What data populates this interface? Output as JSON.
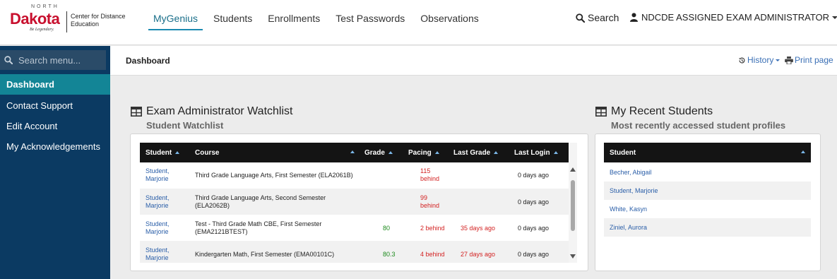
{
  "logo": {
    "north": "NORTH",
    "dakota": "Dakota",
    "tagline": "Be Legendary.",
    "org": "Center for Distance Education"
  },
  "nav": {
    "items": [
      {
        "label": "MyGenius",
        "active": true
      },
      {
        "label": "Students"
      },
      {
        "label": "Enrollments"
      },
      {
        "label": "Test Passwords"
      },
      {
        "label": "Observations"
      }
    ],
    "search_label": "Search",
    "user_label": "NDCDE ASSIGNED EXAM ADMINISTRATOR"
  },
  "sidebar": {
    "search_placeholder": "Search menu...",
    "items": [
      {
        "label": "Dashboard",
        "active": true
      },
      {
        "label": "Contact Support"
      },
      {
        "label": "Edit Account"
      },
      {
        "label": "My Acknowledgements"
      }
    ]
  },
  "breadcrumb": {
    "title": "Dashboard",
    "history_label": "History",
    "print_label": "Print page"
  },
  "watchlist": {
    "title": "Exam Administrator Watchlist",
    "subtitle": "Student Watchlist",
    "columns": [
      "Student",
      "Course",
      "Grade",
      "Pacing",
      "Last Grade",
      "Last Login"
    ],
    "rows": [
      {
        "student": [
          "Student,",
          "Marjorie"
        ],
        "course": [
          "Third Grade Language Arts, First Semester (ELA2061B)"
        ],
        "grade": "",
        "pacing": [
          "115",
          "behind"
        ],
        "last_grade": "",
        "last_login": "0 days ago"
      },
      {
        "student": [
          "Student,",
          "Marjorie"
        ],
        "course": [
          "Third Grade Language Arts, Second Semester",
          "(ELA2062B)"
        ],
        "grade": "",
        "pacing": [
          "99",
          "behind"
        ],
        "last_grade": "",
        "last_login": "0 days ago"
      },
      {
        "student": [
          "Student,",
          "Marjorie"
        ],
        "course": [
          "Test - Third Grade Math CBE, First Semester",
          "(EMA2121BTEST)"
        ],
        "grade": "80",
        "pacing": [
          "2 behind"
        ],
        "last_grade": "35 days ago",
        "last_login": "0 days ago"
      },
      {
        "student": [
          "Student,",
          "Marjorie"
        ],
        "course": [
          "Kindergarten Math, First Semester (EMA00101C)"
        ],
        "grade": "80.3",
        "pacing": [
          "4 behind"
        ],
        "last_grade": "27 days ago",
        "last_login": "0 days ago"
      }
    ]
  },
  "recent": {
    "title": "My Recent Students",
    "subtitle": "Most recently accessed student profiles",
    "column": "Student",
    "students": [
      "Becher, Abigail",
      "Student, Marjorie",
      "White, Kasyn",
      "Ziniel, Aurora"
    ]
  },
  "colors": {
    "sidebar_bg": "#0b3a62",
    "sidebar_active": "#138596",
    "nav_active": "#1a6f8a",
    "link": "#2a5ea8",
    "danger": "#d32222",
    "success": "#1c8a1c"
  }
}
